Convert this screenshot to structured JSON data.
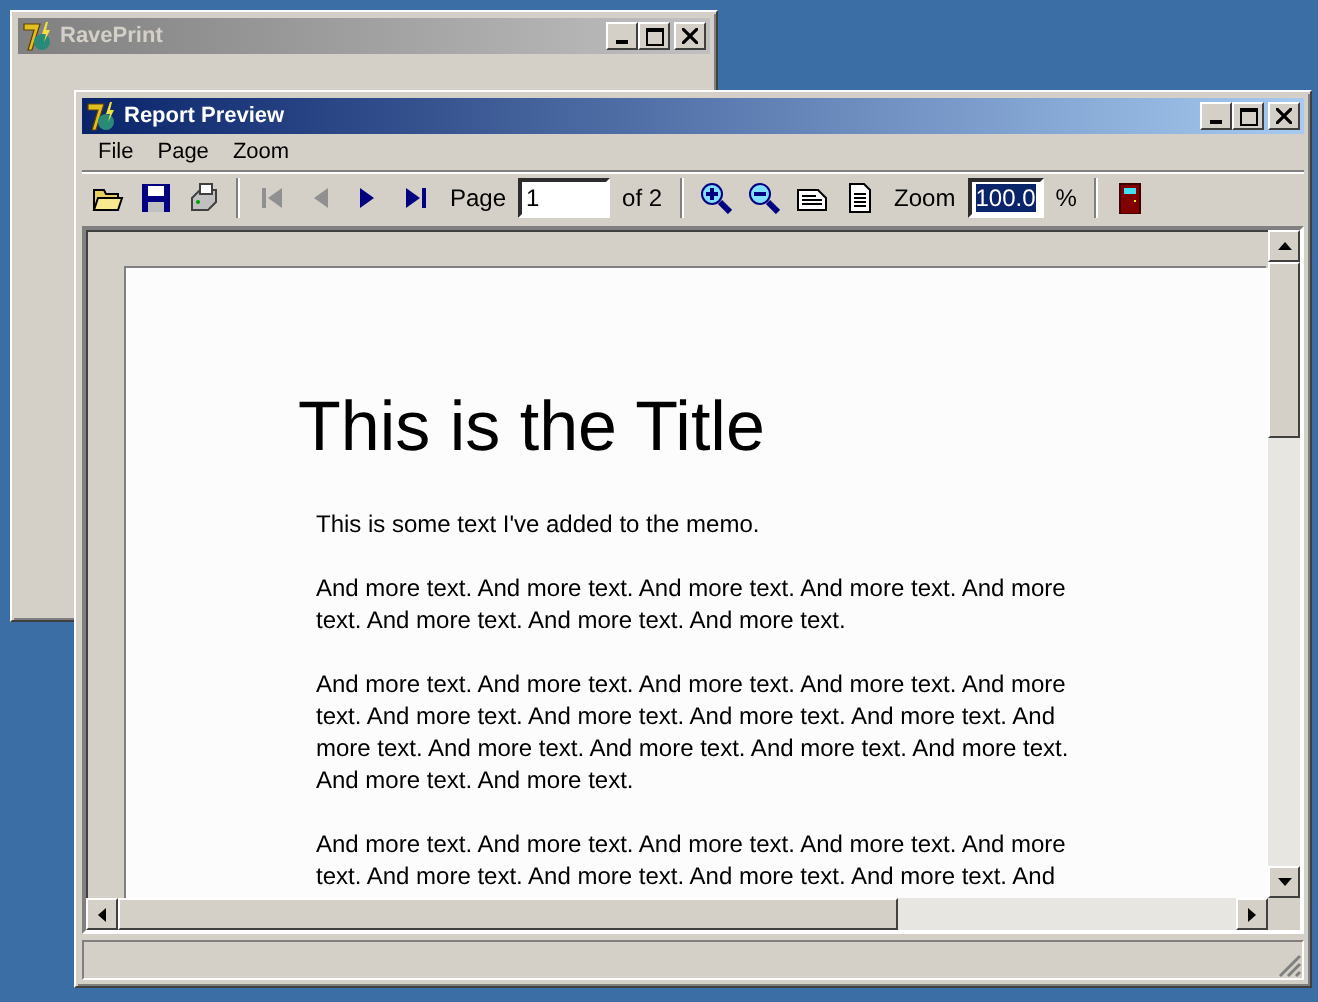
{
  "back_window": {
    "title": "RavePrint",
    "active": false
  },
  "window": {
    "title": "Report Preview",
    "active": true
  },
  "menu": [
    "File",
    "Page",
    "Zoom"
  ],
  "toolbar": {
    "buttons": [
      {
        "kind": "open"
      },
      {
        "kind": "save"
      },
      {
        "kind": "print"
      },
      {
        "kind": "separator"
      },
      {
        "kind": "first",
        "disabled": true
      },
      {
        "kind": "prev",
        "disabled": true
      },
      {
        "kind": "next",
        "disabled": false
      },
      {
        "kind": "last",
        "disabled": false
      },
      {
        "kind": "page_label",
        "text": "Page"
      },
      {
        "kind": "page_field",
        "text": "1"
      },
      {
        "kind": "page_total",
        "text": "of 2"
      },
      {
        "kind": "separator"
      },
      {
        "kind": "zoom_in"
      },
      {
        "kind": "zoom_out"
      },
      {
        "kind": "page_width"
      },
      {
        "kind": "whole_page"
      },
      {
        "kind": "zoom_label",
        "text": "Zoom"
      },
      {
        "kind": "zoom_field",
        "text": "100.0"
      },
      {
        "kind": "zoom_unit",
        "text": "%"
      },
      {
        "kind": "separator"
      },
      {
        "kind": "exit"
      }
    ]
  },
  "document": {
    "title": "This is the Title",
    "paragraphs": [
      [
        "This is some text I've added to the memo."
      ],
      [
        "And more text. And more text. And more text. And more text. And more",
        "text. And more text. And more text. And more text."
      ],
      [
        "And more text. And more text. And more text. And more text. And more",
        "text. And more text. And more text. And more text. And more text. And",
        "more text. And more text. And more text. And more text. And more text.",
        "And more text. And more text."
      ],
      [
        "And more text. And more text. And more text. And more text. And more",
        "text. And more text. And more text. And more text. And more text. And"
      ]
    ]
  }
}
